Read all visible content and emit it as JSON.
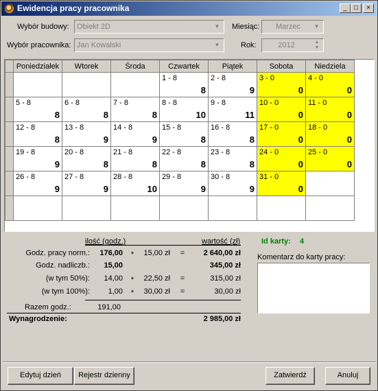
{
  "window": {
    "title": "Ewidencja pracy pracownika",
    "controls": {
      "minimize": "_",
      "maximize": "□",
      "close": "×"
    }
  },
  "filters": {
    "building_label": "Wybór budowy:",
    "building_value": "Obiekt 2D",
    "employee_label": "Wybór pracownika:",
    "employee_value": "Jan Kowalski",
    "month_label": "Miesiąc:",
    "month_value": "Marzec",
    "year_label": "Rok:",
    "year_value": "2012"
  },
  "calendar": {
    "days": [
      "Poniedziałek",
      "Wtorek",
      "Środa",
      "Czwartek",
      "Piątek",
      "Sobota",
      "Niedziela"
    ],
    "weeks": [
      [
        {
          "label": "",
          "hours": ""
        },
        {
          "label": "",
          "hours": ""
        },
        {
          "label": "",
          "hours": ""
        },
        {
          "label": "1 - 8",
          "hours": "8"
        },
        {
          "label": "2 - 8",
          "hours": "9"
        },
        {
          "label": "3 - 0",
          "hours": "0"
        },
        {
          "label": "4 - 0",
          "hours": "0"
        }
      ],
      [
        {
          "label": "5 - 8",
          "hours": "8"
        },
        {
          "label": "6 - 8",
          "hours": "8"
        },
        {
          "label": "7 - 8",
          "hours": "8"
        },
        {
          "label": "8 - 8",
          "hours": "10"
        },
        {
          "label": "9 - 8",
          "hours": "11"
        },
        {
          "label": "10 - 0",
          "hours": "0"
        },
        {
          "label": "11 - 0",
          "hours": "0"
        }
      ],
      [
        {
          "label": "12 - 8",
          "hours": "8"
        },
        {
          "label": "13 - 8",
          "hours": "9"
        },
        {
          "label": "14 - 8",
          "hours": "9"
        },
        {
          "label": "15 - 8",
          "hours": "8"
        },
        {
          "label": "16 - 8",
          "hours": "8"
        },
        {
          "label": "17 - 0",
          "hours": "0"
        },
        {
          "label": "18 - 0",
          "hours": "0"
        }
      ],
      [
        {
          "label": "19 - 8",
          "hours": "9"
        },
        {
          "label": "20 - 8",
          "hours": "8"
        },
        {
          "label": "21 - 8",
          "hours": "8"
        },
        {
          "label": "22 - 8",
          "hours": "8"
        },
        {
          "label": "23 - 8",
          "hours": "8"
        },
        {
          "label": "24 - 0",
          "hours": "0"
        },
        {
          "label": "25 - 0",
          "hours": "0"
        }
      ],
      [
        {
          "label": "26 - 8",
          "hours": "9"
        },
        {
          "label": "27 - 8",
          "hours": "9"
        },
        {
          "label": "28 - 8",
          "hours": "10"
        },
        {
          "label": "29 - 8",
          "hours": "9"
        },
        {
          "label": "30 - 8",
          "hours": "9"
        },
        {
          "label": "31 - 0",
          "hours": "0"
        },
        {
          "label": "",
          "hours": ""
        }
      ],
      [
        {
          "label": "",
          "hours": ""
        },
        {
          "label": "",
          "hours": ""
        },
        {
          "label": "",
          "hours": ""
        },
        {
          "label": "",
          "hours": ""
        },
        {
          "label": "",
          "hours": ""
        },
        {
          "label": "",
          "hours": ""
        },
        {
          "label": "",
          "hours": ""
        }
      ]
    ],
    "weekend_color": "#ffff00"
  },
  "summary": {
    "qty_header": "ilość (godz.)",
    "value_header": "wartość (zł)",
    "rows": [
      {
        "label": "Godz. pracy norm.:",
        "qty": "176,00",
        "op1": "*",
        "rate": "15,00 zł",
        "op2": "=",
        "value": "2 640,00 zł",
        "bold": true
      },
      {
        "label": "Godz. nadliczb.:",
        "qty": "15,00",
        "op1": "",
        "rate": "",
        "op2": "",
        "value": "345,00 zł",
        "bold": true
      },
      {
        "label": "(w tym 50%):",
        "qty": "14,00",
        "op1": "*",
        "rate": "22,50 zł",
        "op2": "=",
        "value": "315,00 zł",
        "bold": false
      },
      {
        "label": "(w tym 100%):",
        "qty": "1,00",
        "op1": "*",
        "rate": "30,00 zł",
        "op2": "=",
        "value": "30,00 zł",
        "bold": false
      }
    ],
    "total_hours_label": "Razem godz.:",
    "total_hours": "191,00",
    "salary_label": "Wynagrodzenie:",
    "salary_value": "2 985,00 zł"
  },
  "card": {
    "id_label": "Id karty:",
    "id_value": "4",
    "comment_label": "Komentarz do karty pracy:",
    "comment_value": ""
  },
  "buttons": {
    "edit_day": "Edytuj dzień",
    "daily_register": "Rejestr dzienny",
    "confirm": "Zatwierdź",
    "cancel": "Anuluj"
  }
}
